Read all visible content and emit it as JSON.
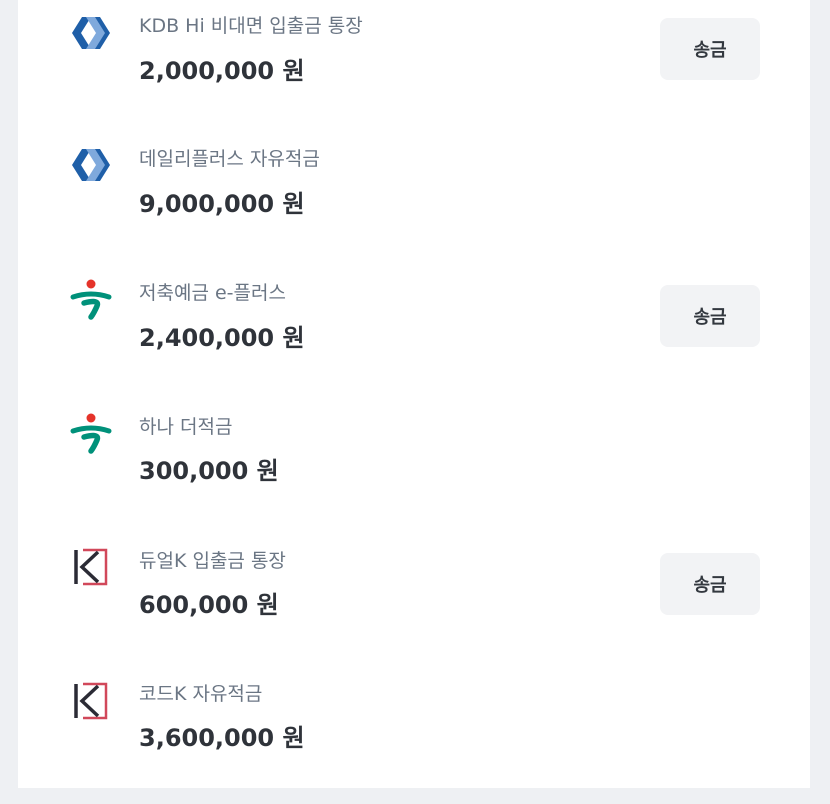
{
  "accounts": [
    {
      "bank_icon": "kdb-bank-icon",
      "name": "KDB Hi 비대면 입출금 통장",
      "amount": "2,000,000 원",
      "action_label": "송금"
    },
    {
      "bank_icon": "kdb-bank-icon",
      "name": "데일리플러스 자유적금",
      "amount": "9,000,000 원"
    },
    {
      "bank_icon": "hana-bank-icon",
      "name": "저축예금 e-플러스",
      "amount": "2,400,000 원",
      "action_label": "송금"
    },
    {
      "bank_icon": "hana-bank-icon",
      "name": "하나 더적금",
      "amount": "300,000 원"
    },
    {
      "bank_icon": "kbank-icon",
      "name": "듀얼K 입출금 통장",
      "amount": "600,000 원",
      "action_label": "송금"
    },
    {
      "bank_icon": "kbank-icon",
      "name": "코드K 자유적금",
      "amount": "3,600,000 원"
    }
  ],
  "colors": {
    "kdb_blue": "#1f5fa8",
    "hana_green": "#00917a",
    "hana_red": "#e5332a",
    "kbank_red": "#d1485a",
    "kbank_dark": "#2b2b35",
    "button_bg": "#f2f3f5",
    "name_text": "#6b7684",
    "amount_text": "#2f333a"
  }
}
